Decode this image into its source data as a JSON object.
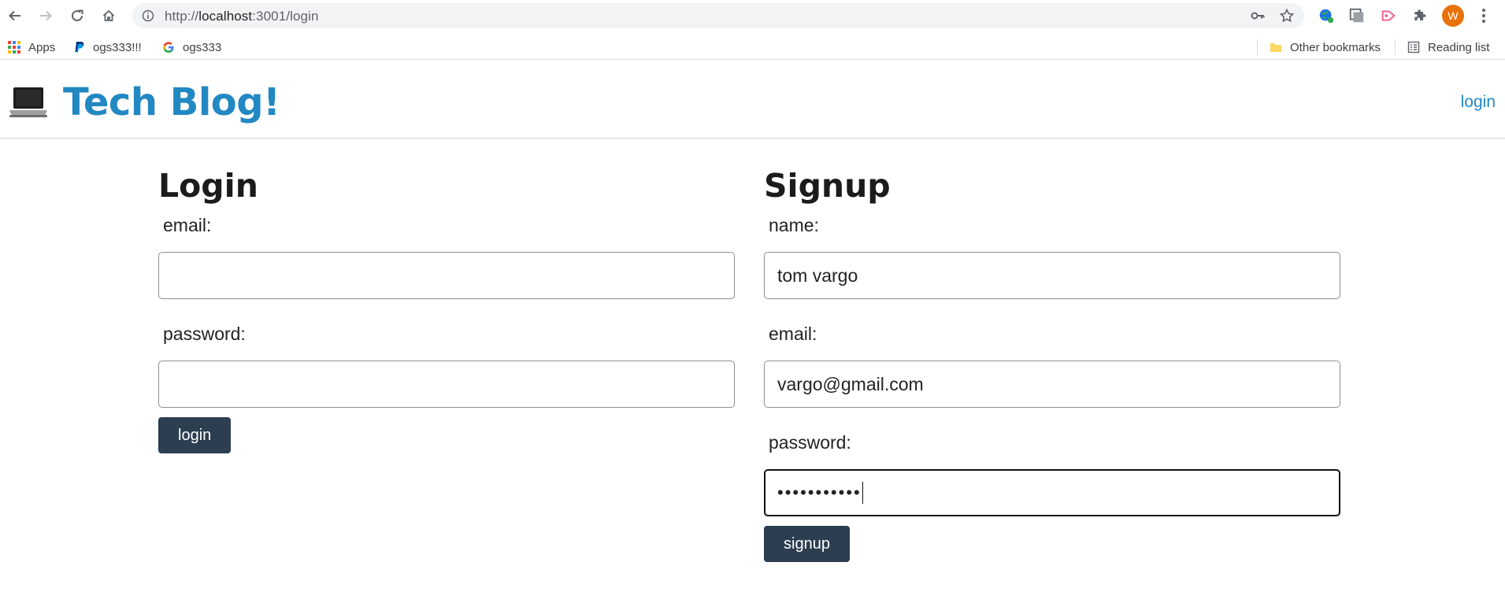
{
  "browser": {
    "url_prefix": "http://",
    "url_host": "localhost",
    "url_path": ":3001/login",
    "profile_initial": "W",
    "colors": {
      "avatar": "#e8710a",
      "omnibox": "#f1f3f4"
    },
    "bookmarks": [
      {
        "label": "Apps",
        "icon": "apps-grid-icon"
      },
      {
        "label": "ogs333!!!",
        "icon": "paypal-icon"
      },
      {
        "label": "ogs333",
        "icon": "google-icon"
      }
    ],
    "right_bookmarks": [
      {
        "label": "Other bookmarks",
        "icon": "folder-icon"
      },
      {
        "label": "Reading list",
        "icon": "reading-list-icon"
      }
    ]
  },
  "site": {
    "title": "Tech Blog!",
    "logo_icon": "laptop-icon",
    "nav_login": "login",
    "colors": {
      "brand": "#2288c2",
      "button": "#2c3e50"
    }
  },
  "login_form": {
    "heading": "Login",
    "email_label": "email:",
    "email_value": "",
    "password_label": "password:",
    "password_value": "",
    "submit_label": "login"
  },
  "signup_form": {
    "heading": "Signup",
    "name_label": "name:",
    "name_value": "tom vargo",
    "email_label": "email:",
    "email_value": "vargo@gmail.com",
    "password_label": "password:",
    "password_display": "•••••••••••",
    "submit_label": "signup"
  }
}
